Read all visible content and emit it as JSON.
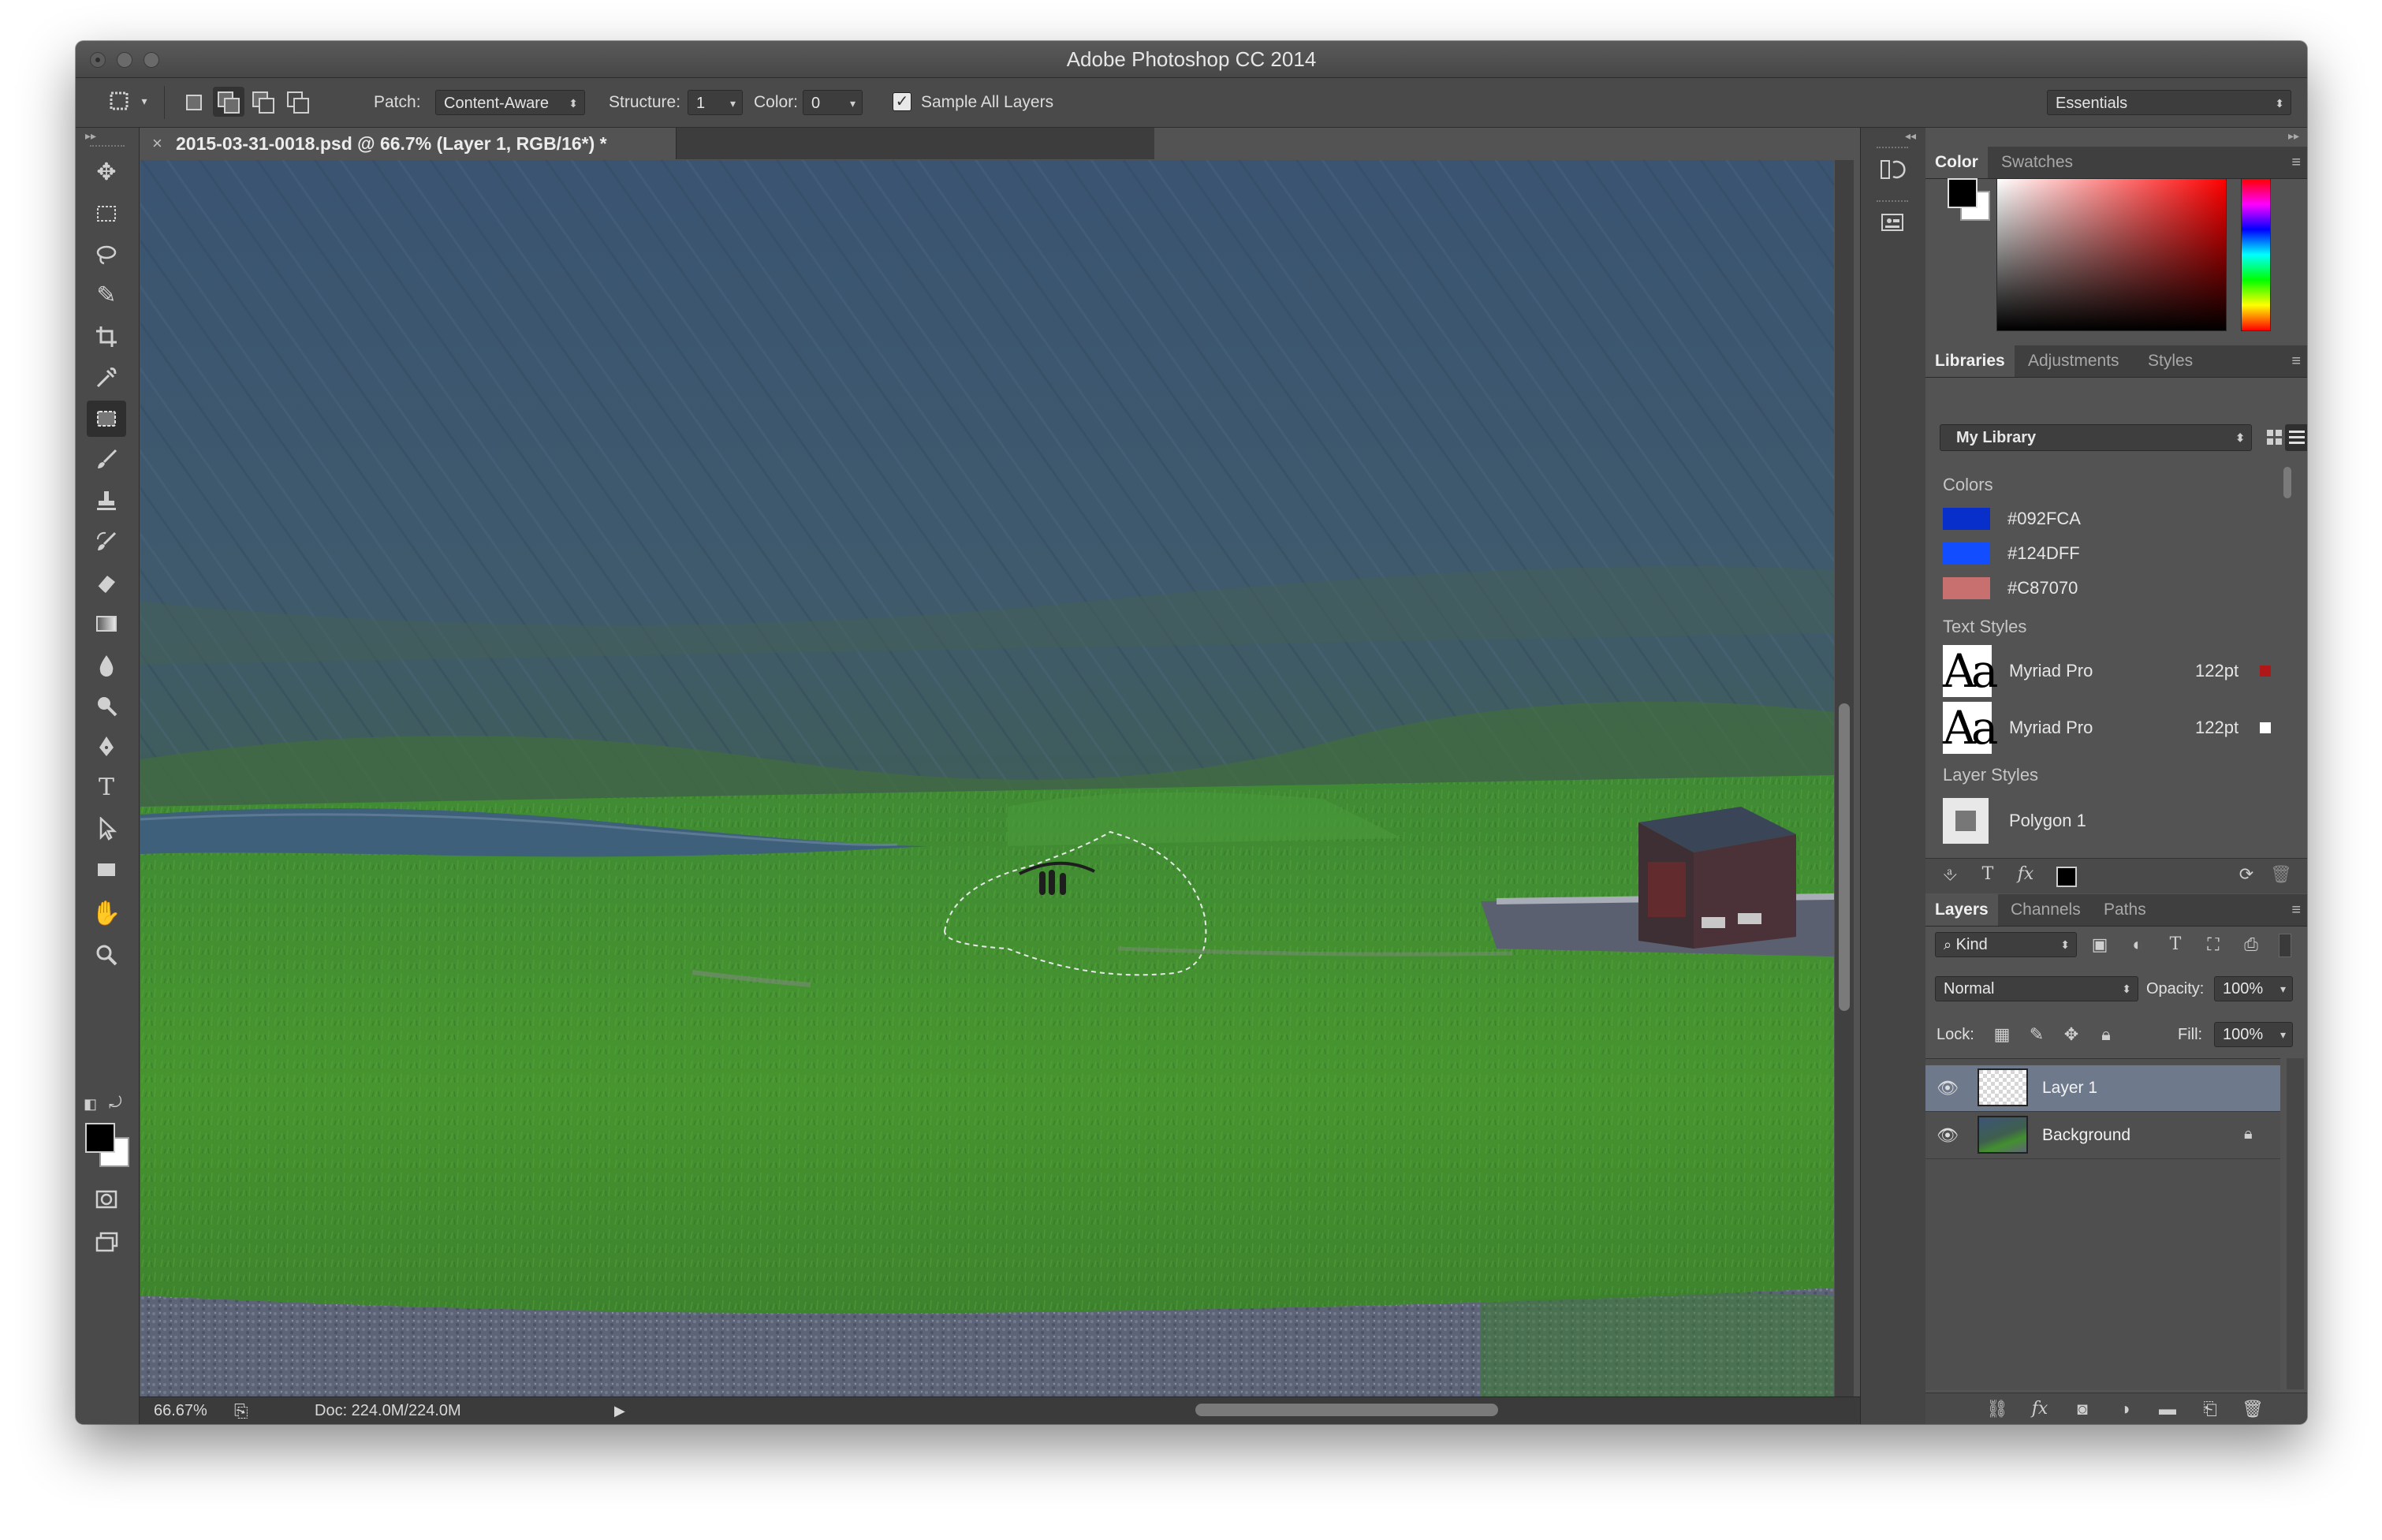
{
  "window": {
    "title": "Adobe Photoshop CC 2014"
  },
  "options_bar": {
    "patch_label": "Patch:",
    "patch_value": "Content-Aware",
    "structure_label": "Structure:",
    "structure_value": "1",
    "color_label": "Color:",
    "color_value": "0",
    "sample_all_layers_label": "Sample All Layers",
    "sample_all_layers_checked": true,
    "workspace": "Essentials"
  },
  "document": {
    "tab_title": "2015-03-31-0018.psd @ 66.7% (Layer 1, RGB/16*) *",
    "close_glyph": "×"
  },
  "status": {
    "zoom": "66.67%",
    "doc_size": "Doc: 224.0M/224.0M"
  },
  "color_panel": {
    "tabs": [
      "Color",
      "Swatches"
    ],
    "foreground": "#000000",
    "background": "#ffffff",
    "hue": "#ff0000"
  },
  "libraries_panel": {
    "tabs": [
      "Libraries",
      "Adjustments",
      "Styles"
    ],
    "library": "My Library",
    "colors_heading": "Colors",
    "colors": [
      {
        "label": "#092FCA",
        "hex": "#092FCA"
      },
      {
        "label": "#124DFF",
        "hex": "#124DFF"
      },
      {
        "label": "#C87070",
        "hex": "#C87070"
      }
    ],
    "text_styles_heading": "Text Styles",
    "text_styles": [
      {
        "thumb": "Aa",
        "font": "Myriad Pro",
        "size": "122pt",
        "color": "#b01818"
      },
      {
        "thumb": "Aa",
        "font": "Myriad Pro",
        "size": "122pt",
        "color": "#ffffff"
      }
    ],
    "layer_styles_heading": "Layer Styles",
    "layer_styles": [
      {
        "name": "Polygon 1"
      }
    ]
  },
  "layers_panel": {
    "tabs": [
      "Layers",
      "Channels",
      "Paths"
    ],
    "filter": "Kind",
    "blend_mode": "Normal",
    "opacity_label": "Opacity:",
    "opacity": "100%",
    "lock_label": "Lock:",
    "fill_label": "Fill:",
    "fill": "100%",
    "layers": [
      {
        "name": "Layer 1",
        "selected": true
      },
      {
        "name": "Background",
        "selected": false,
        "locked": true
      }
    ]
  }
}
